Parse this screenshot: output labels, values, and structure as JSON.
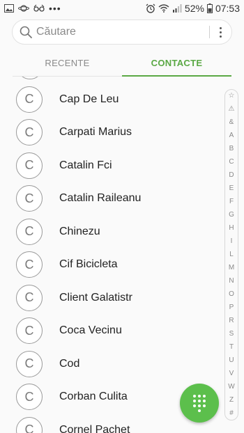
{
  "status_bar": {
    "battery": "52%",
    "time": "07:53",
    "icons": [
      "gallery-icon",
      "planet-icon",
      "glasses-icon",
      "more-dots-icon",
      "alarm-icon",
      "wifi-icon",
      "signal-icon",
      "battery-icon"
    ]
  },
  "search": {
    "placeholder": "Căutare"
  },
  "tabs": [
    {
      "label": "RECENTE",
      "active": false
    },
    {
      "label": "CONTACTE",
      "active": true
    }
  ],
  "contacts": [
    {
      "initial": "C",
      "name": "Cap De Leu"
    },
    {
      "initial": "C",
      "name": "Carpati Marius"
    },
    {
      "initial": "C",
      "name": "Catalin Fci"
    },
    {
      "initial": "C",
      "name": "Catalin Raileanu"
    },
    {
      "initial": "C",
      "name": "Chinezu"
    },
    {
      "initial": "C",
      "name": "Cif Bicicleta"
    },
    {
      "initial": "C",
      "name": "Client Galatistr"
    },
    {
      "initial": "C",
      "name": "Coca Vecinu"
    },
    {
      "initial": "C",
      "name": "Cod"
    },
    {
      "initial": "C",
      "name": "Corban Culita"
    },
    {
      "initial": "C",
      "name": "Cornel Pachet"
    }
  ],
  "index_letters": [
    "☆",
    "⚠",
    "&",
    "A",
    "B",
    "C",
    "D",
    "E",
    "F",
    "G",
    "H",
    "I",
    "L",
    "M",
    "N",
    "O",
    "P",
    "R",
    "S",
    "T",
    "U",
    "V",
    "W",
    "Z",
    "#"
  ],
  "colors": {
    "accent": "#5aa844",
    "fab": "#5cbf4c"
  },
  "fab": {
    "icon": "dialpad-icon"
  }
}
